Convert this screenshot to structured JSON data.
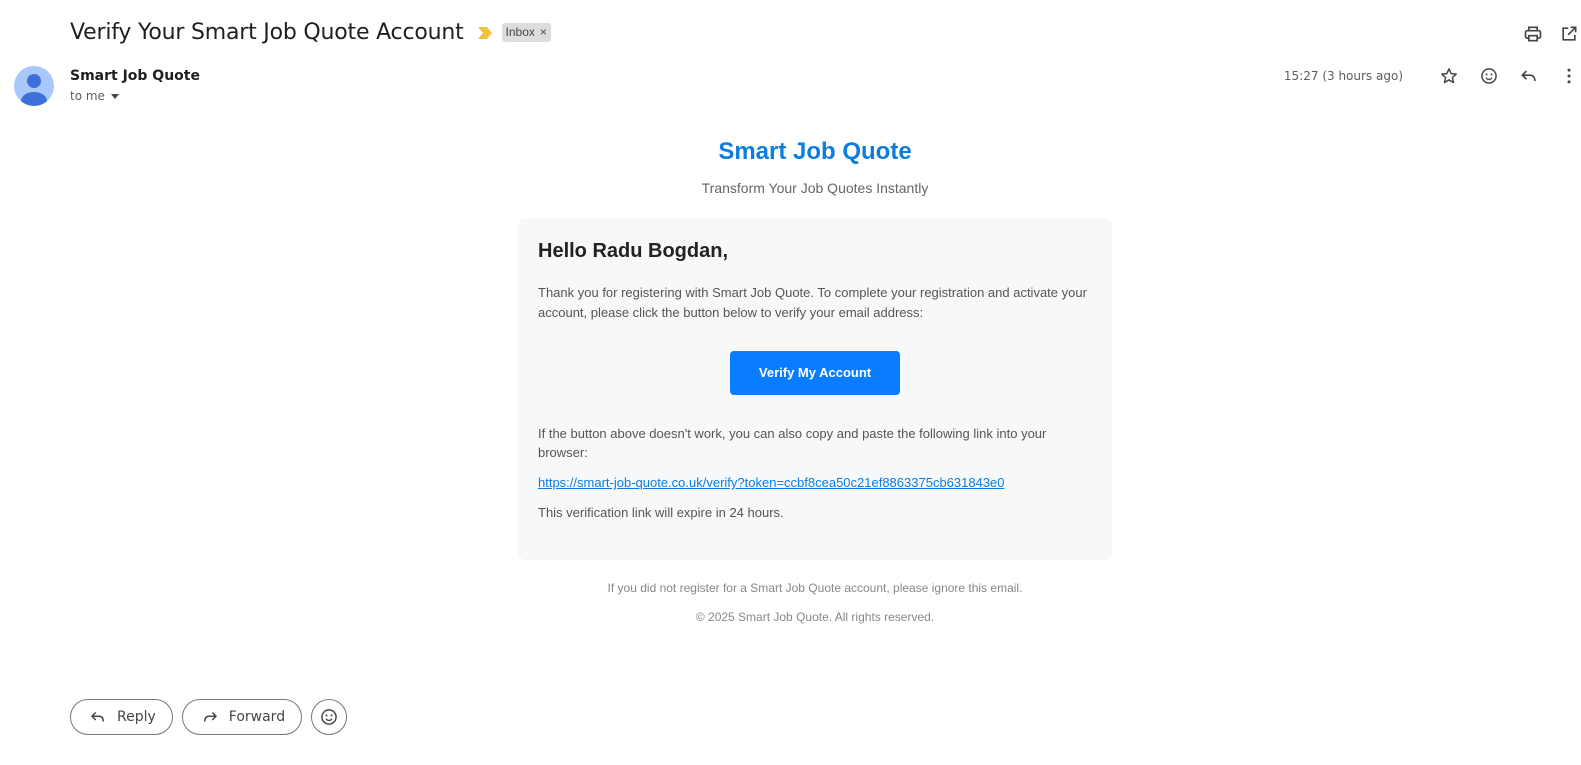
{
  "email": {
    "subject": "Verify Your Smart Job Quote Account",
    "label": "Inbox",
    "label_remove": "×",
    "sender_name": "Smart Job Quote",
    "recipient": "to me",
    "timestamp": "15:27 (3 hours ago)"
  },
  "body": {
    "brand": "Smart Job Quote",
    "tagline": "Transform Your Job Quotes Instantly",
    "greeting": "Hello Radu Bogdan,",
    "intro": "Thank you for registering with Smart Job Quote. To complete your registration and activate your account, please click the button below to verify your email address:",
    "button_label": "Verify My Account",
    "fallback_text": "If the button above doesn't work, you can also copy and paste the following link into your browser:",
    "verify_link": "https://smart-job-quote.co.uk/verify?token=ccbf8cea50c21ef8863375cb631843e0",
    "expiry": "This verification link will expire in 24 hours.",
    "footer_ignore": "If you did not register for a Smart Job Quote account, please ignore this email.",
    "footer_copyright": "© 2025 Smart Job Quote. All rights reserved."
  },
  "actions": {
    "reply_label": "Reply",
    "forward_label": "Forward"
  },
  "colors": {
    "brand_blue": "#0b7ee0",
    "button_blue": "#0a7cff",
    "card_bg": "#f7f8fa",
    "importance_marker": "#f2c13d",
    "avatar_bg": "#a8c7fa"
  },
  "icons": [
    "print-icon",
    "open-in-new-window-icon",
    "star-icon",
    "emoji-reaction-icon",
    "reply-icon",
    "more-vert-icon",
    "importance-marker-icon",
    "forward-icon"
  ]
}
